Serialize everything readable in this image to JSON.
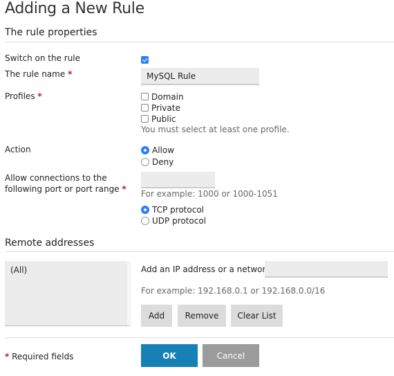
{
  "page": {
    "title": "Adding a New Rule"
  },
  "rule_properties": {
    "section_title": "The rule properties",
    "switch_on": {
      "label": "Switch on the rule",
      "checked": true
    },
    "rule_name": {
      "label": "The rule name",
      "required_mark": "*",
      "value": "MySQL Rule"
    },
    "profiles": {
      "label": "Profiles",
      "required_mark": "*",
      "options": [
        {
          "label": "Domain",
          "checked": false
        },
        {
          "label": "Private",
          "checked": false
        },
        {
          "label": "Public",
          "checked": false
        }
      ],
      "hint": "You must select at least one profile."
    },
    "action": {
      "label": "Action",
      "options": [
        {
          "label": "Allow",
          "selected": true
        },
        {
          "label": "Deny",
          "selected": false
        }
      ]
    },
    "port": {
      "label_line1": "Allow connections to the",
      "label_line2": "following port or port range",
      "required_mark": "*",
      "value": "",
      "hint": "For example: 1000 or 1000-1051"
    },
    "protocol": {
      "options": [
        {
          "label": "TCP protocol",
          "selected": true
        },
        {
          "label": "UDP protocol",
          "selected": false
        }
      ]
    }
  },
  "remote_addresses": {
    "section_title": "Remote addresses",
    "list_items": [
      "(All)"
    ],
    "add_label": "Add an IP address or a network:",
    "add_value": "",
    "hint": "For example: 192.168.0.1 or 192.168.0.0/16",
    "buttons": {
      "add": "Add",
      "remove": "Remove",
      "clear": "Clear List"
    }
  },
  "footer": {
    "required_mark": "*",
    "required_text": "Required fields",
    "ok": "OK",
    "cancel": "Cancel"
  },
  "colors": {
    "accent": "#2d7ff9",
    "ok_button": "#1781b5",
    "cancel_button": "#9b9b9b",
    "required": "#c8102e"
  }
}
